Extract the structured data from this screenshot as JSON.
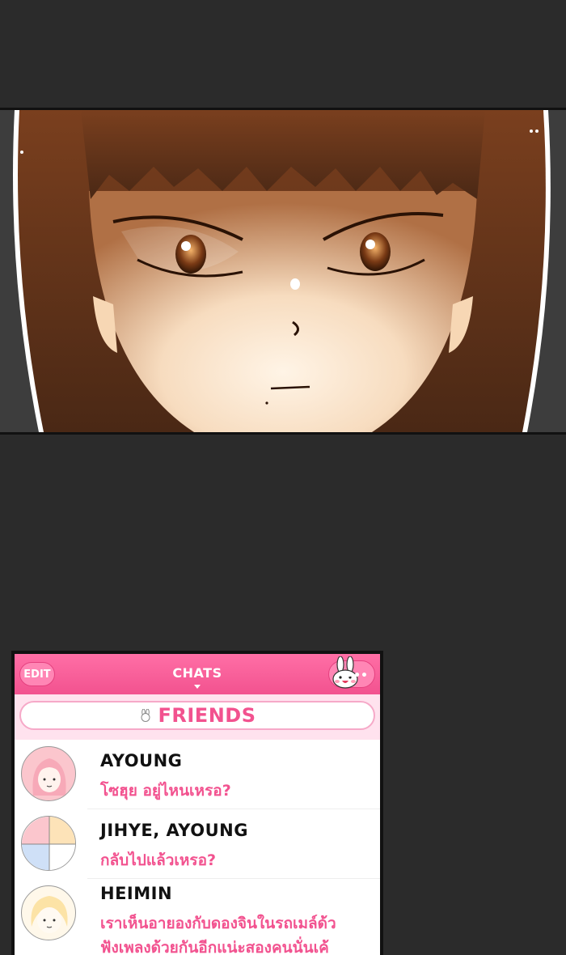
{
  "chat_app": {
    "edit_label": "EDIT",
    "tab_title": "CHATS",
    "more_label": "•••",
    "friends_label": "FRIENDS",
    "accent_color": "#f2528f",
    "chats": [
      {
        "name": "AYOUNG",
        "message": "โซฮุย อยู่ไหนเหรอ?",
        "avatar_icon": "girl-face-avatar-icon"
      },
      {
        "name": "JIHYE, AYOUNG",
        "message": "กลับไปแล้วเหรอ?",
        "avatar_icon": "group-avatar-icon"
      },
      {
        "name": "HEIMIN",
        "message": "เราเห็นอายองกับดองจินในรถเมล์ด้ว",
        "message_line2": "ฟังเพลงด้วยกันอีกแน่ะสองคนนั่นเค้",
        "avatar_icon": "girl-face-avatar-icon"
      }
    ]
  }
}
